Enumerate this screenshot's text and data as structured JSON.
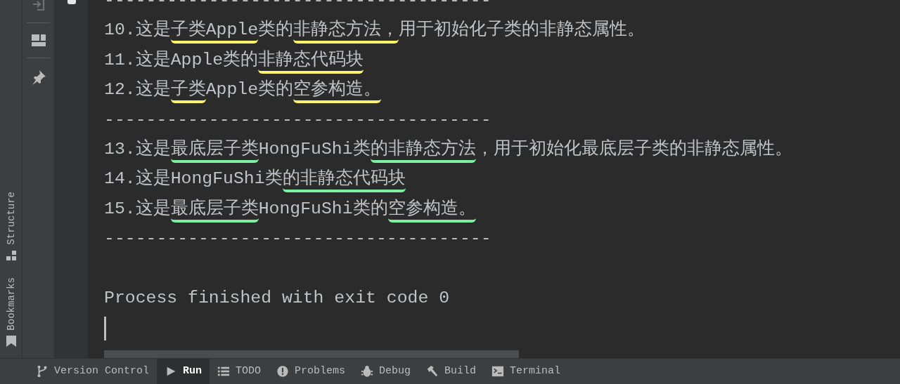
{
  "left_stripe": {
    "tabs": [
      {
        "label": "Structure",
        "kind": "structure"
      },
      {
        "label": "Bookmarks",
        "kind": "bookmarks"
      }
    ]
  },
  "console": {
    "lines": [
      {
        "kind": "separator",
        "text": "-------------------------------------"
      },
      {
        "kind": "output",
        "parts": [
          {
            "text": "10.这是"
          },
          {
            "text": "子类Apple",
            "color": "#fdf46b"
          },
          {
            "text": "类的"
          },
          {
            "text": "非静态方法，",
            "color": "#fdf46b"
          },
          {
            "text": "用于初始化子类的非静态属性。"
          }
        ]
      },
      {
        "kind": "output",
        "parts": [
          {
            "text": "11.这是Apple类的"
          },
          {
            "text": "非静态代码块",
            "color": "#fdf46b"
          }
        ]
      },
      {
        "kind": "output",
        "parts": [
          {
            "text": "12.这是"
          },
          {
            "text": "子类",
            "color": "#fdf46b"
          },
          {
            "text": "Apple类的"
          },
          {
            "text": "空参构造。",
            "color": "#fdf46b"
          }
        ]
      },
      {
        "kind": "separator",
        "text": "-------------------------------------"
      },
      {
        "kind": "output",
        "parts": [
          {
            "text": "13.这是"
          },
          {
            "text": "最底层子类",
            "color": "#7cf0a0"
          },
          {
            "text": "HongFuShi类"
          },
          {
            "text": "的非静态方法",
            "color": "#7cf0a0"
          },
          {
            "text": "，用于初始化最底层子类的非静态属性。"
          }
        ]
      },
      {
        "kind": "output",
        "parts": [
          {
            "text": "14.这是HongFuShi类"
          },
          {
            "text": "的非静态代码块",
            "color": "#7cf0a0"
          }
        ]
      },
      {
        "kind": "output",
        "parts": [
          {
            "text": "15.这是"
          },
          {
            "text": "最底层子类",
            "color": "#7cf0a0"
          },
          {
            "text": "HongFuShi类的"
          },
          {
            "text": "空参构造。",
            "color": "#7cf0a0"
          }
        ]
      },
      {
        "kind": "separator",
        "text": "-------------------------------------"
      },
      {
        "kind": "blank"
      },
      {
        "kind": "output",
        "parts": [
          {
            "text": "Process finished with exit code 0"
          }
        ]
      }
    ]
  },
  "bottom_bar": {
    "tabs": [
      {
        "label": "Version Control",
        "kind": "branch",
        "selected": false
      },
      {
        "label": "Run",
        "kind": "play",
        "selected": true
      },
      {
        "label": "TODO",
        "kind": "list",
        "selected": false
      },
      {
        "label": "Problems",
        "kind": "alert",
        "selected": false
      },
      {
        "label": "Debug",
        "kind": "bug",
        "selected": false
      },
      {
        "label": "Build",
        "kind": "hammer",
        "selected": false
      },
      {
        "label": "Terminal",
        "kind": "terminal",
        "selected": false
      }
    ]
  }
}
